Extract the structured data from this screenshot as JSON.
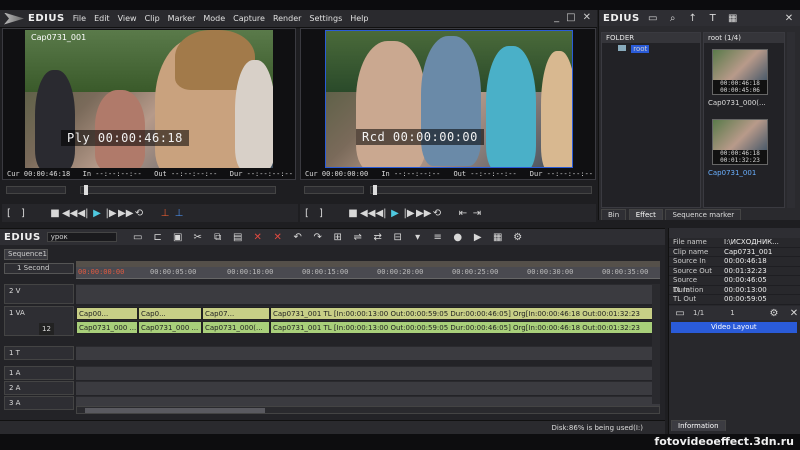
{
  "app": {
    "logo": "EDIUS",
    "menu": [
      "File",
      "Edit",
      "View",
      "Clip",
      "Marker",
      "Mode",
      "Capture",
      "Render",
      "Settings",
      "Help"
    ]
  },
  "player": {
    "clip_label": "Cap0731_001",
    "timecode": "Ply 00:00:46:18",
    "cur": "Cur 00:00:46:18",
    "in": "In  --:--:--:--",
    "out": "Out --:--:--:--",
    "dur": "Dur --:--:--:--"
  },
  "recorder": {
    "timecode": "Rcd 00:00:00:00",
    "cur": "Cur 00:00:00:00",
    "in": "In  --:--:--:--",
    "out": "Out --:--:--:--",
    "dur": "Dur --:--:--:--"
  },
  "bin": {
    "logo": "EDIUS",
    "folder_header": "FOLDER",
    "root": "root",
    "content_header": "root (1/4)",
    "thumbs": [
      {
        "tc1": "00:00:46:18",
        "tc2": "00:00:45:06",
        "label": "Cap0731_000(..."
      },
      {
        "tc1": "00:00:46:18",
        "tc2": "00:01:32:23",
        "label": "Cap0731_001"
      }
    ],
    "tabs": [
      "Bin",
      "Effect",
      "Sequence marker"
    ]
  },
  "timeline": {
    "logo": "EDIUS",
    "project": "урок",
    "sequence_tab": "Sequence1",
    "scale": "1 Second",
    "ruler": [
      "00:00:00:00",
      "00:00:05:00",
      "00:00:10:00",
      "00:00:15:00",
      "00:00:20:00",
      "00:00:25:00",
      "00:00:30:00",
      "00:00:35:00"
    ],
    "tracks": {
      "v2": "2 V",
      "va1": "1 VA",
      "va1_audio": "12",
      "t1": "1 T",
      "a1": "1 A",
      "a2": "2 A",
      "a3": "3 A"
    },
    "video_clips": [
      "Cap00...",
      "Cap0...",
      "Cap07...",
      "Cap0731_001  TL [In:00:00:13:00 Out:00:00:59:05 Dur:00:00:46:05]  Org[In:00:00:46:18 Out:00:01:32:23"
    ],
    "audio_clips": [
      "Cap0731_000 ...",
      "Cap0731_000 ...",
      "Cap0731_000(...",
      "Cap0731_001  TL [In:00:00:13:00 Out:00:00:59:05 Dur:00:00:46:05]  Org[In:00:00:46:18 Out:00:01:32:23"
    ],
    "status": "Disk:86% is being used(I:)"
  },
  "info": {
    "rows": [
      {
        "k": "File name",
        "v": "I:\\ИСХОДНИК..."
      },
      {
        "k": "Clip name",
        "v": "Cap0731_001"
      },
      {
        "k": "Source In",
        "v": "00:00:46:18"
      },
      {
        "k": "Source Out",
        "v": "00:01:32:23"
      },
      {
        "k": "Source Duration",
        "v": "00:00:46:05"
      },
      {
        "k": "TL In",
        "v": "00:00:13:00"
      },
      {
        "k": "TL Out",
        "v": "00:00:59:05"
      }
    ],
    "pager": "1/1",
    "layer_count": "1",
    "layer_item": "Video Layout",
    "tab": "Information"
  },
  "watermark": "fotovideoeffect.3dn.ru",
  "colors": {
    "accent": "#4fc9e0",
    "video_clip": "#c8cf86",
    "audio_clip": "#a8cf7a",
    "selection": "#2a5bd8"
  }
}
